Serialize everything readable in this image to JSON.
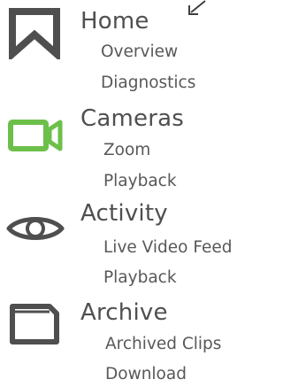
{
  "nav": {
    "home": {
      "title": "Home",
      "icon": "bookmark-icon",
      "items": [
        "Overview",
        "Diagnostics"
      ]
    },
    "cameras": {
      "title": "Cameras",
      "icon": "video-camera-icon",
      "items": [
        "Zoom",
        "Playback"
      ]
    },
    "activity": {
      "title": "Activity",
      "icon": "eye-icon",
      "items": [
        "Live Video Feed",
        "Playback"
      ]
    },
    "archive": {
      "title": "Archive",
      "icon": "folder-icon",
      "items": [
        "Archived Clips",
        "Download"
      ]
    }
  },
  "colors": {
    "icon_default": "#4f4f4f",
    "icon_active": "#6cc04a",
    "text": "#4f4f4f"
  },
  "cursor_icon": "cursor-arrow-icon"
}
